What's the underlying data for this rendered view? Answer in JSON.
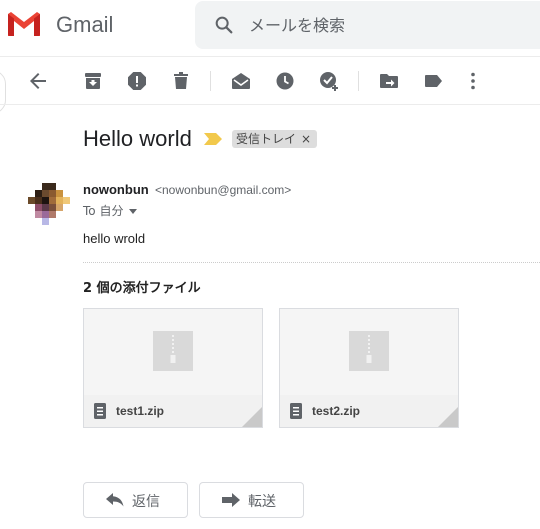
{
  "app": {
    "logo_text": "Gmail",
    "brand_colors": [
      "#ea4335",
      "#4285f4",
      "#34a853",
      "#fbbc04",
      "#c5221f"
    ]
  },
  "search": {
    "placeholder": "メールを検索",
    "icon": "search-icon"
  },
  "toolbar": {
    "icons": [
      "back-arrow-icon",
      "archive-icon",
      "report-spam-icon",
      "delete-icon",
      "mark-unread-icon",
      "snooze-icon",
      "add-to-tasks-icon",
      "move-to-icon",
      "labels-icon",
      "more-vert-icon"
    ]
  },
  "message": {
    "subject": "Hello world",
    "label": "受信トレイ",
    "label_close": "×",
    "sender_name": "nowonbun",
    "sender_email": "<nowonbun@gmail.com>",
    "to_text": "To 自分",
    "body": "hello wrold",
    "important_color": "#f2c94c"
  },
  "attachments": {
    "heading": "2 個の添付ファイル",
    "files": [
      {
        "name": "test1.zip",
        "icon": "zip-file-icon"
      },
      {
        "name": "test2.zip",
        "icon": "zip-file-icon"
      }
    ]
  },
  "actions": {
    "reply_label": "返信",
    "forward_label": "転送"
  }
}
